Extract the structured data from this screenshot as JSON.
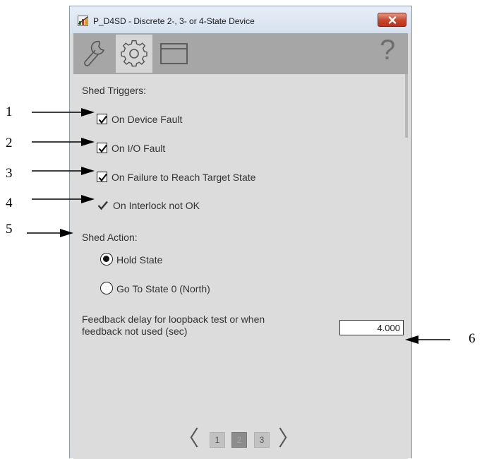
{
  "window": {
    "title": "P_D4SD - Discrete 2-, 3- or 4-State Device",
    "close_label": "close"
  },
  "toolbar": {
    "tabs": [
      {
        "icon": "wrench-icon",
        "selected": false
      },
      {
        "icon": "gear-icon",
        "selected": true
      },
      {
        "icon": "window-icon",
        "selected": false
      }
    ],
    "help_label": "?"
  },
  "shed_triggers": {
    "heading": "Shed Triggers:",
    "items": [
      {
        "label": "On Device Fault",
        "checked": true
      },
      {
        "label": "On I/O Fault",
        "checked": true
      },
      {
        "label": "On Failure to Reach Target State",
        "checked": true
      },
      {
        "label": "On Interlock not OK",
        "checked": true
      }
    ]
  },
  "shed_action": {
    "heading": "Shed Action:",
    "options": [
      {
        "label": "Hold State",
        "selected": true
      },
      {
        "label": "Go To State 0 (North)",
        "selected": false
      }
    ]
  },
  "feedback": {
    "label_line1": "Feedback delay for loopback test or when",
    "label_line2": "feedback not used (sec)",
    "value": "4.000"
  },
  "pagination": {
    "prev": "〈",
    "next": "〉",
    "pages": [
      "1",
      "2",
      "3"
    ],
    "current": "2"
  },
  "callouts": [
    "1",
    "2",
    "3",
    "4",
    "5",
    "6"
  ]
}
